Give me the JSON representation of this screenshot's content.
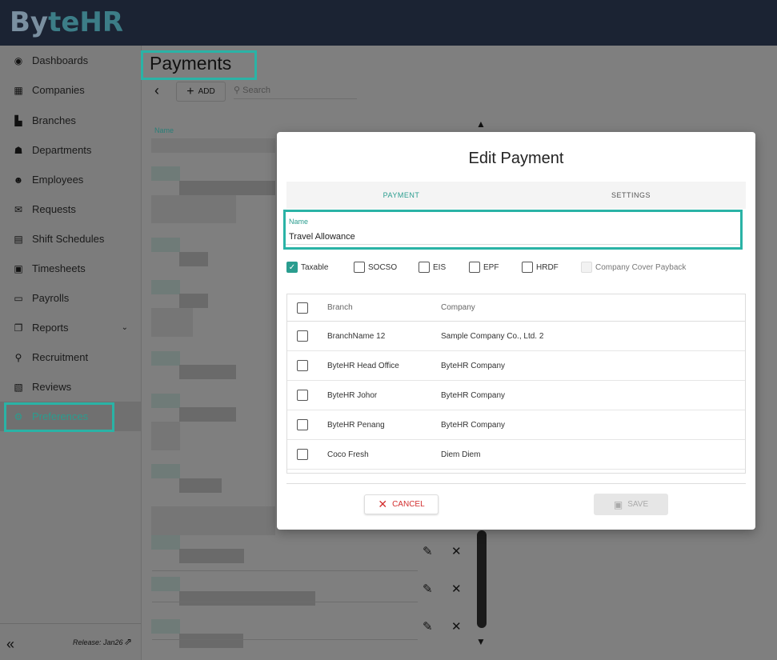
{
  "app": {
    "logo_prefix": "B",
    "logo_mid": "y",
    "logo_te": "te",
    "logo_hr": "HR"
  },
  "sidebar": {
    "items": [
      {
        "label": "Dashboards",
        "icon": "dashboard-icon"
      },
      {
        "label": "Companies",
        "icon": "building-icon"
      },
      {
        "label": "Branches",
        "icon": "branch-icon"
      },
      {
        "label": "Departments",
        "icon": "sitemap-icon"
      },
      {
        "label": "Employees",
        "icon": "users-icon"
      },
      {
        "label": "Requests",
        "icon": "envelope-icon"
      },
      {
        "label": "Shift Schedules",
        "icon": "calendar-icon"
      },
      {
        "label": "Timesheets",
        "icon": "timesheet-icon"
      },
      {
        "label": "Payrolls",
        "icon": "money-icon"
      },
      {
        "label": "Reports",
        "icon": "copy-icon"
      },
      {
        "label": "Recruitment",
        "icon": "user-search-icon"
      },
      {
        "label": "Reviews",
        "icon": "review-icon"
      },
      {
        "label": "Preferences",
        "icon": "gears-icon"
      }
    ],
    "release": "Release: Jan26"
  },
  "page": {
    "title": "Payments",
    "add_label": "ADD",
    "search_placeholder": "Search",
    "list_name_header": "Name"
  },
  "modal": {
    "title": "Edit Payment",
    "tabs": [
      "PAYMENT",
      "SETTINGS"
    ],
    "name_label": "Name",
    "name_value": "Travel Allowance",
    "options": [
      {
        "label": "Taxable",
        "checked": true
      },
      {
        "label": "SOCSO",
        "checked": false
      },
      {
        "label": "EIS",
        "checked": false
      },
      {
        "label": "EPF",
        "checked": false
      },
      {
        "label": "HRDF",
        "checked": false
      },
      {
        "label": "Company Cover Payback",
        "checked": false,
        "disabled": true
      }
    ],
    "table": {
      "headers": [
        "Branch",
        "Company"
      ],
      "rows": [
        [
          "BranchName 12",
          "Sample Company Co., Ltd. 2"
        ],
        [
          "ByteHR Head Office",
          "ByteHR Company"
        ],
        [
          "ByteHR Johor",
          "ByteHR Company"
        ],
        [
          "ByteHR Penang",
          "ByteHR Company"
        ],
        [
          "Coco Fresh",
          "Diem Diem"
        ]
      ]
    },
    "cancel_label": "CANCEL",
    "save_label": "SAVE"
  },
  "colors": {
    "accent": "#2a9d8f",
    "highlight": "#2ab3a6",
    "topbar": "#1b2333",
    "cancel": "#d32f2f"
  }
}
